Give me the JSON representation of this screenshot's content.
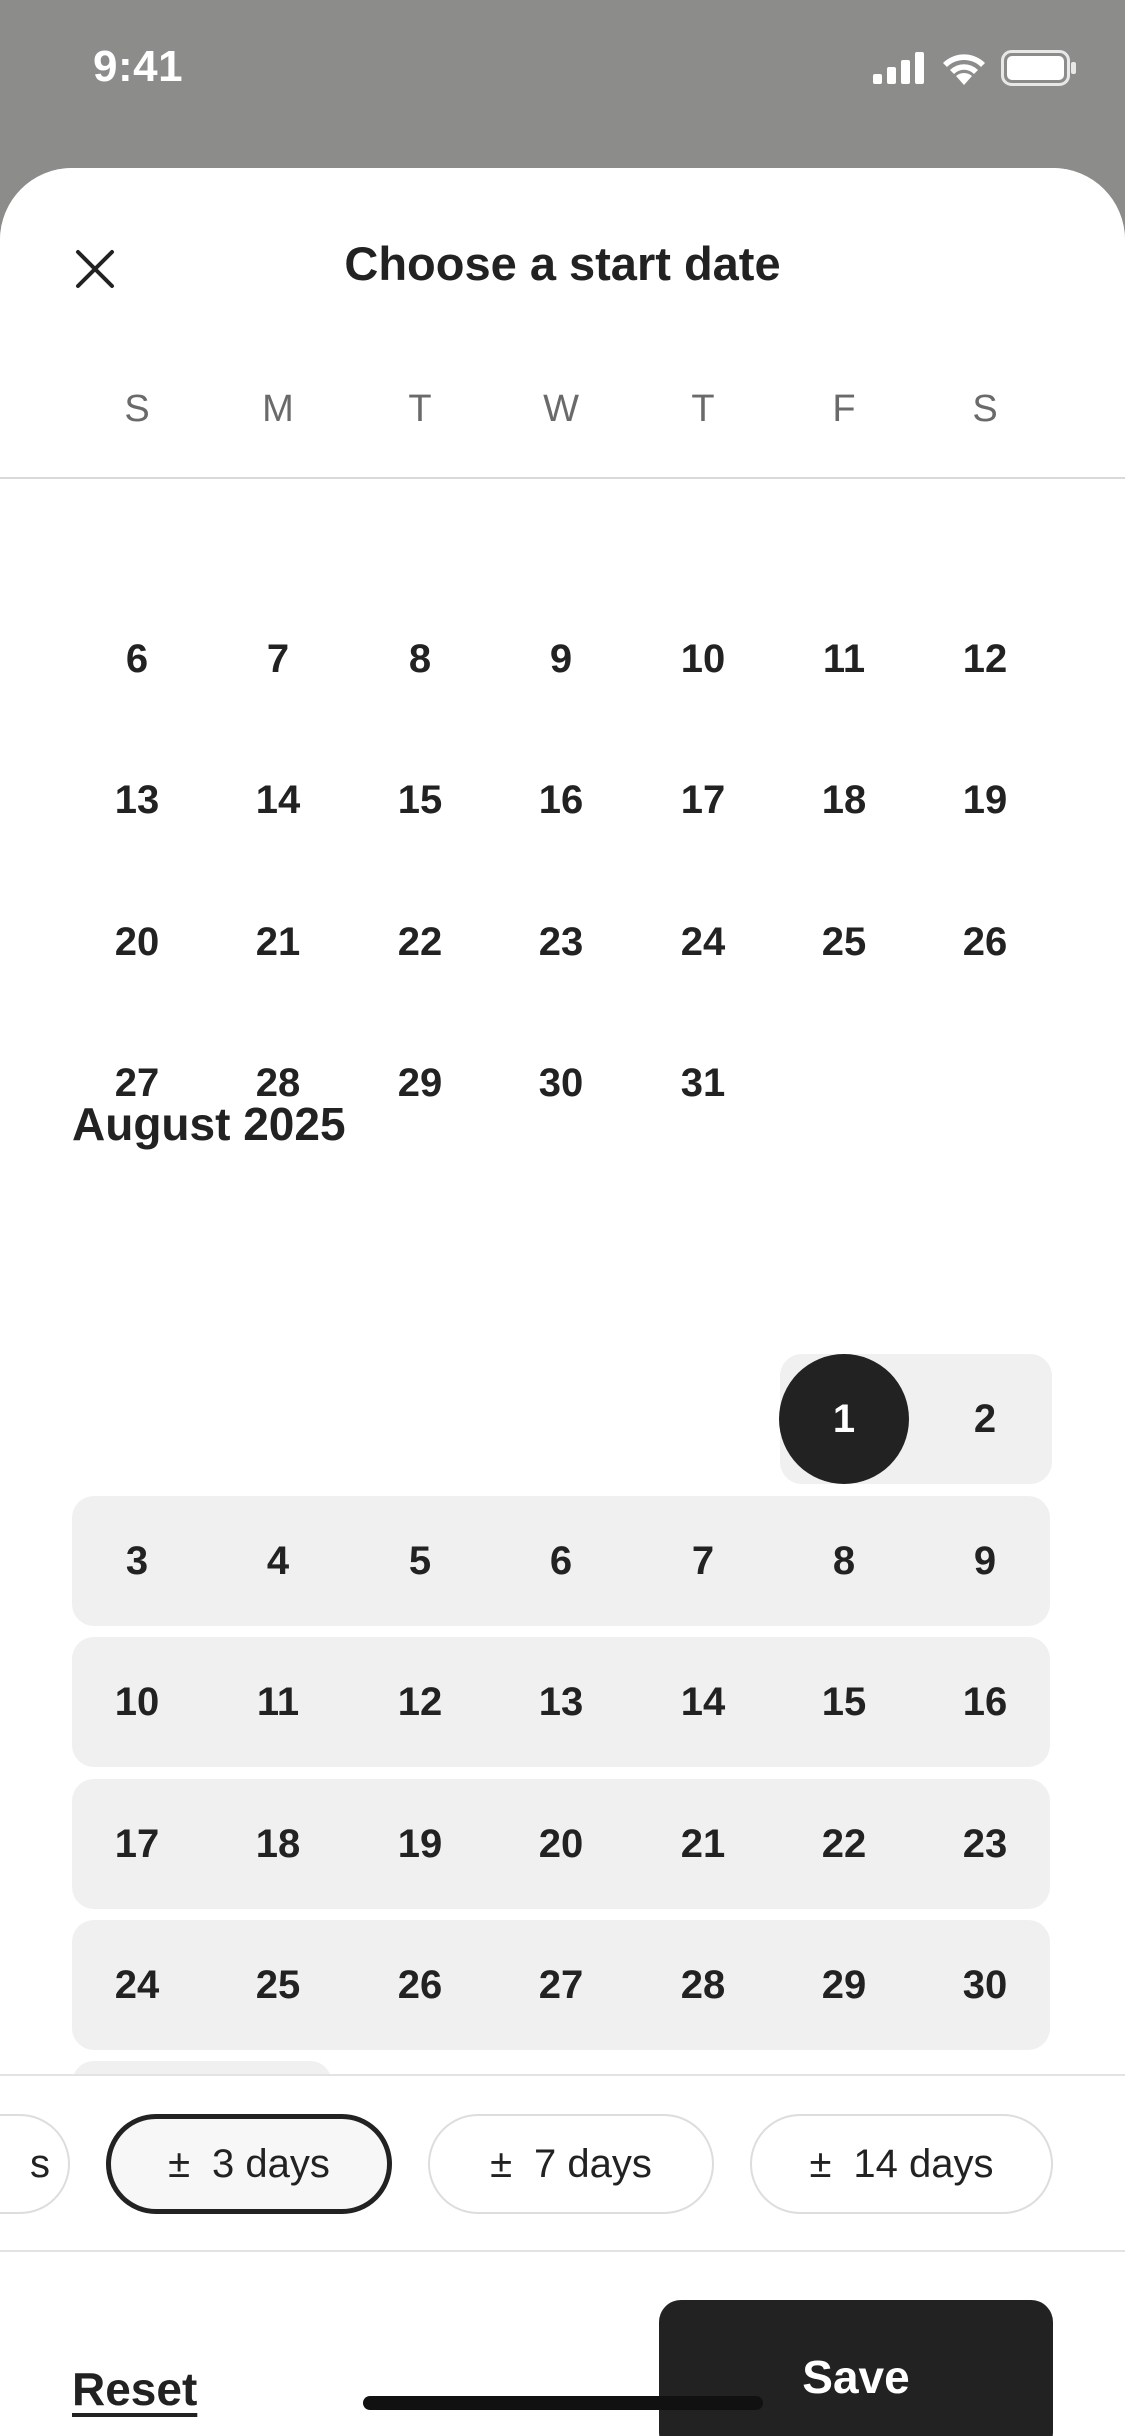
{
  "status": {
    "time": "9:41"
  },
  "header": {
    "title": "Choose a start date",
    "weekdays": [
      "S",
      "M",
      "T",
      "W",
      "T",
      "F",
      "S"
    ]
  },
  "july_partial": [
    [
      "6",
      "7",
      "8",
      "9",
      "10",
      "11",
      "12"
    ],
    [
      "13",
      "14",
      "15",
      "16",
      "17",
      "18",
      "19"
    ],
    [
      "20",
      "21",
      "22",
      "23",
      "24",
      "25",
      "26"
    ],
    [
      "27",
      "28",
      "29",
      "30",
      "31",
      "",
      ""
    ]
  ],
  "august": {
    "label": "August 2025",
    "weeks": [
      [
        "",
        "",
        "",
        "",
        "",
        "1",
        "2"
      ],
      [
        "3",
        "4",
        "5",
        "6",
        "7",
        "8",
        "9"
      ],
      [
        "10",
        "11",
        "12",
        "13",
        "14",
        "15",
        "16"
      ],
      [
        "17",
        "18",
        "19",
        "20",
        "21",
        "22",
        "23"
      ],
      [
        "24",
        "25",
        "26",
        "27",
        "28",
        "29",
        "30"
      ]
    ],
    "selected": "1"
  },
  "flex_options": {
    "partial": "s",
    "chips": [
      {
        "symbol": "±",
        "label": "3 days",
        "active": true
      },
      {
        "symbol": "±",
        "label": "7 days",
        "active": false
      },
      {
        "symbol": "±",
        "label": "14 days",
        "active": false
      }
    ]
  },
  "footer": {
    "reset": "Reset",
    "save": "Save"
  },
  "colors": {
    "accent": "#222222",
    "range": "#f0f0f0",
    "backdrop": "#8c8c8a"
  }
}
